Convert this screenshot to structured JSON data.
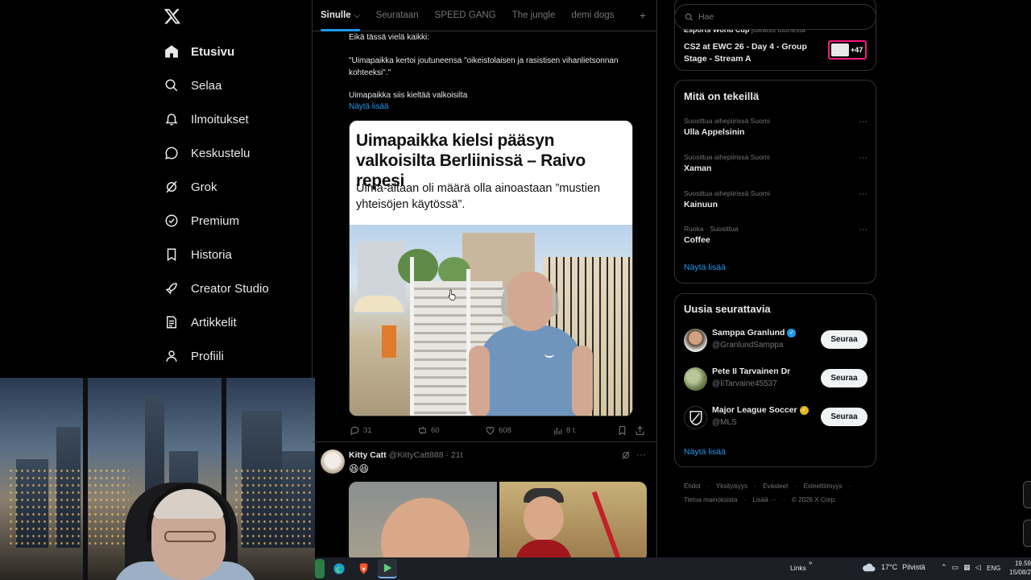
{
  "sidebar": {
    "logo": "x-logo-icon",
    "items": [
      {
        "label": "Etusivu",
        "icon": "home-icon",
        "active": true
      },
      {
        "label": "Selaa",
        "icon": "search-icon"
      },
      {
        "label": "Ilmoitukset",
        "icon": "bell-icon"
      },
      {
        "label": "Keskustelu",
        "icon": "chat-icon"
      },
      {
        "label": "Grok",
        "icon": "grok-icon"
      },
      {
        "label": "Premium",
        "icon": "verified-badge-icon"
      },
      {
        "label": "Historia",
        "icon": "bookmark-icon"
      },
      {
        "label": "Creator Studio",
        "icon": "rocket-icon"
      },
      {
        "label": "Artikkelit",
        "icon": "article-icon"
      },
      {
        "label": "Profiili",
        "icon": "person-icon"
      }
    ]
  },
  "tabs": {
    "items": [
      "Sinulle",
      "Seurataan",
      "SPEED GANG",
      "The jungle",
      "demi dogs"
    ],
    "active_chevron": "⌵",
    "add": "+"
  },
  "post1": {
    "line1": "Eikä tässä vielä kaikki:",
    "line2": "\"Uimapaikka kertoi joutuneensa \"oikeistolaisen ja rasistisen vihanlietsonnan kohteeksi\".\"",
    "line3": "Uimapaikka siis kieltää valkoisilta",
    "show_more": "Näytä lisää",
    "article": {
      "headline": "Uimapaikka kielsi pääsyn valkoisilta Berliinissä – Raivo repesi",
      "subheadline": "Uima-altaan oli määrä olla ainoastaan ”mustien yhteisöjen käytössä”."
    },
    "stats": {
      "replies": "31",
      "reposts": "60",
      "likes": "608",
      "views": "8 t."
    }
  },
  "post2": {
    "name": "Kitty Catt",
    "handle": "@KittyCatt888",
    "time": "· 21t",
    "emoji": "😆😆"
  },
  "search": {
    "placeholder": "Hae"
  },
  "live": {
    "top_strong": "Esports World Cup",
    "top_rest": "julkaisu tuohesta",
    "title": "CS2 at EWC 26 - Day 4 - Group Stage - Stream A",
    "count": "+47"
  },
  "trends": {
    "title": "Mitä on tekeillä",
    "items": [
      {
        "context": "Suosittua aihepiirissä Suomi",
        "name": "Ulla Appelsinin"
      },
      {
        "context": "Suosittua aihepiirissä Suomi",
        "name": "Xaman"
      },
      {
        "context": "Suosittua aihepiirissä Suomi",
        "name": "Kainuun"
      },
      {
        "context": "Ruoka · Suosittua",
        "name": "Coffee"
      }
    ],
    "more_glyph": "···",
    "show_more": "Näytä lisää"
  },
  "follow": {
    "title": "Uusia seurattavia",
    "button": "Seuraa",
    "items": [
      {
        "name": "Samppa Granlund",
        "handle": "@GranlundSamppa",
        "badge_color": "#1d9bf0"
      },
      {
        "name": "Pete II Tarvainen Dr",
        "handle": "@IiTarvaine45537",
        "badge_color": ""
      },
      {
        "name": "Major League Soccer",
        "handle": "@MLS",
        "badge_color": "#e2b719"
      }
    ],
    "show_more": "Näytä lisää"
  },
  "footer": {
    "links": [
      "Ehdot",
      "·",
      "Yksityisyys",
      "·",
      "Evästeet",
      "·",
      "Esteettömyys",
      "·",
      "Tietoa mainoksista",
      "·",
      "Lisää ···",
      "·",
      "© 2026 X Corp."
    ]
  },
  "taskbar": {
    "links": "Links",
    "links_chevron": "»",
    "temperature": "17°C",
    "weather": "Pilvistä",
    "lang": "ENG",
    "time": "19.59",
    "date": "15/08/2"
  },
  "colors": {
    "accent": "#1d9bf0",
    "live_border": "#f91880",
    "background": "#000000"
  }
}
